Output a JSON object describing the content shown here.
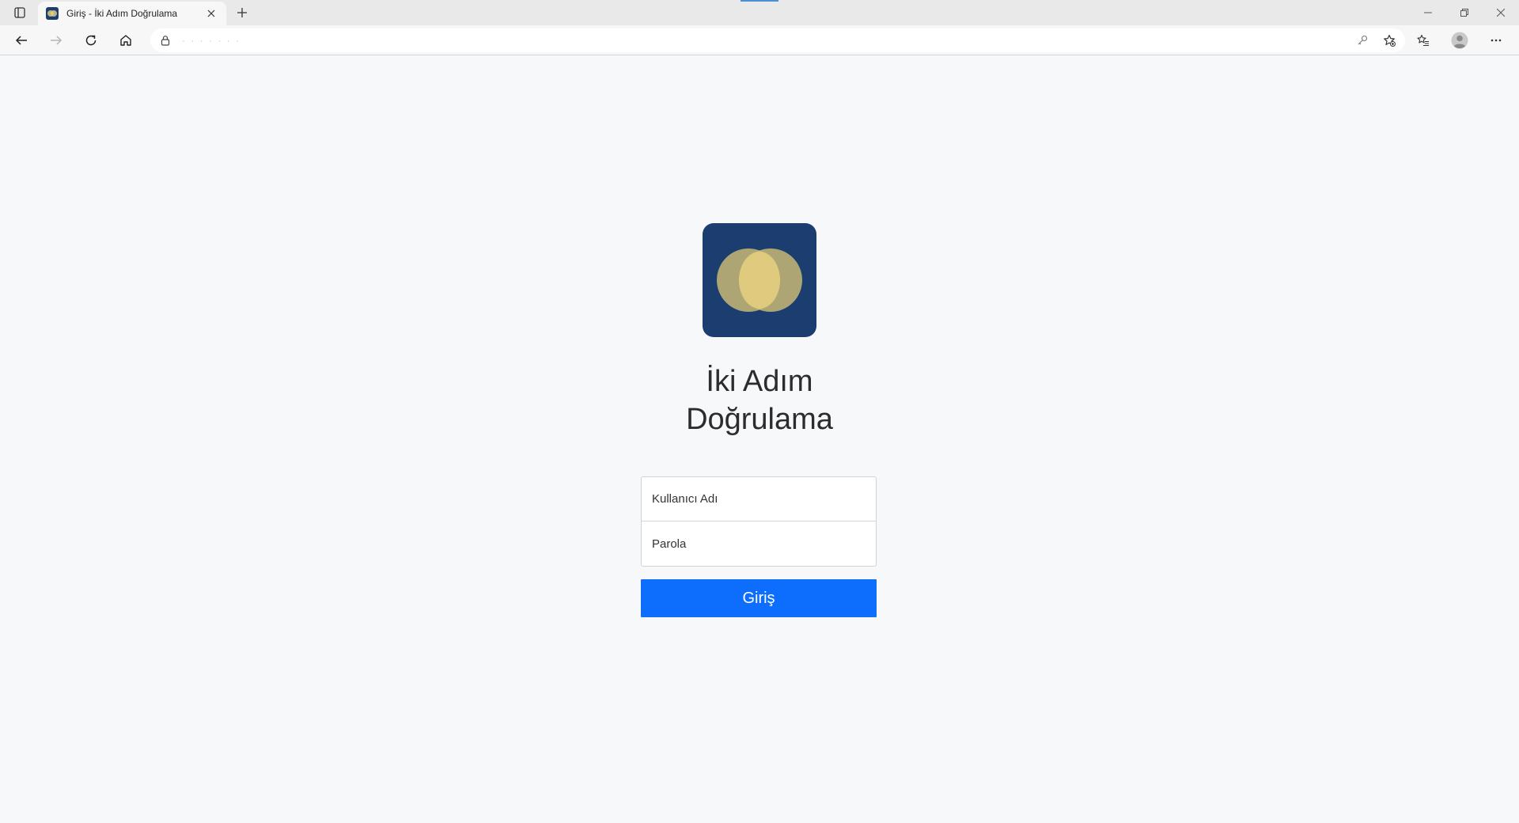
{
  "browser": {
    "tab_title": "Giriş - İki Adım Doğrulama",
    "address_url": "· · · · · · ·",
    "accent": "#4a90d9"
  },
  "page": {
    "heading_line1": "İki Adım",
    "heading_line2": "Doğrulama",
    "username_placeholder": "Kullanıcı Adı",
    "password_placeholder": "Parola",
    "submit_label": "Giriş",
    "submit_color": "#0d6efd",
    "logo_bg": "#1b3d6f",
    "logo_circle_color": "#d6c476"
  }
}
